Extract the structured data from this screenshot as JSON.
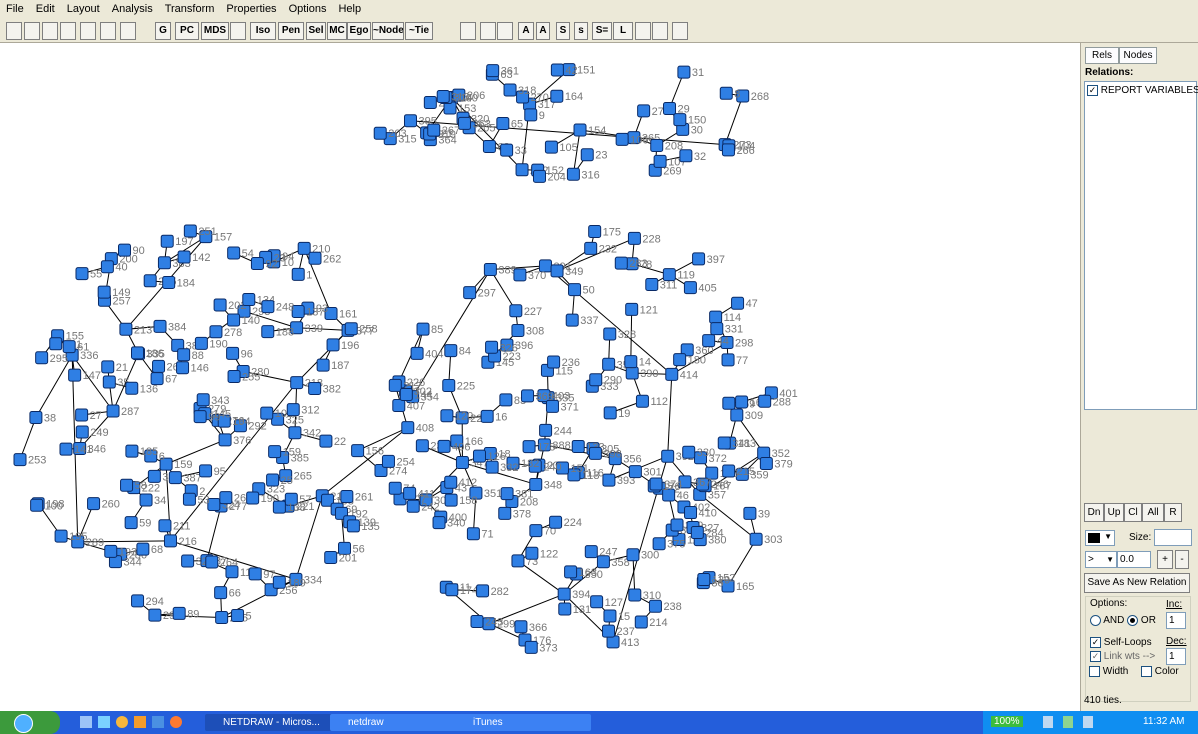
{
  "menu": [
    "File",
    "Edit",
    "Layout",
    "Analysis",
    "Transform",
    "Properties",
    "Options",
    "Help"
  ],
  "toolbar_labels": [
    "G",
    "PC",
    "MDS",
    "Iso",
    "Pen",
    "Sel",
    "MC",
    "Ego",
    "~Node",
    "~Tie",
    "A",
    "A",
    "S",
    "s",
    "S=",
    "L"
  ],
  "side": {
    "tab_rels": "Rels",
    "tab_nodes": "Nodes",
    "relations_label": "Relations:",
    "relation_item": "REPORT VARIABLES F",
    "btn_dn": "Dn",
    "btn_up": "Up",
    "btn_cl": "Cl",
    "btn_all": "All",
    "btn_r": "R",
    "size_label": "Size:",
    "op_value": ">",
    "threshold": "0.0",
    "btn_plus": "+",
    "btn_minus": "-",
    "save_btn": "Save As New Relation",
    "options_label": "Options:",
    "inc_label": "Inc:",
    "inc_value": "1",
    "and_label": "AND",
    "or_label": "OR",
    "self_loops": "Self-Loops",
    "dec_label": "Dec:",
    "dec_value": "1",
    "link_wts": "Link wts -->",
    "width_label": "Width",
    "color_label": "Color",
    "status": "410 ties."
  },
  "taskbar": {
    "btn1": "NETDRAW - Micros...",
    "btn2": "netdraw",
    "btn3": "iTunes",
    "battery": "100%",
    "clock": "11:32 AM"
  },
  "colors": {
    "node_fill": "#2f7fe4",
    "node_stroke": "#0a2a66",
    "label": "#777777"
  },
  "network": {
    "labels": [
      "395",
      "365",
      "321",
      "273",
      "200",
      "272",
      "317",
      "320",
      "270",
      "207",
      "154",
      "268",
      "208",
      "271",
      "364",
      "318",
      "269",
      "205",
      "153",
      "107",
      "62",
      "104",
      "316",
      "363",
      "206",
      "151",
      "106",
      "65",
      "30",
      "63",
      "29",
      "319",
      "315",
      "267",
      "105",
      "164",
      "152",
      "31",
      "8",
      "42",
      "9",
      "33",
      "23",
      "361",
      "204",
      "150",
      "314",
      "266",
      "203",
      "313",
      "32",
      "414",
      "392",
      "391",
      "389",
      "413",
      "393",
      "356",
      "354",
      "390",
      "388",
      "394",
      "357",
      "358",
      "353",
      "305",
      "355",
      "348",
      "347",
      "352",
      "306",
      "299",
      "349",
      "350",
      "303",
      "301",
      "300",
      "359",
      "351",
      "302",
      "229",
      "165",
      "227",
      "298",
      "307",
      "360",
      "231",
      "228",
      "226",
      "297",
      "234",
      "309",
      "308",
      "232",
      "166",
      "114",
      "167",
      "74",
      "115",
      "236",
      "310",
      "116",
      "169",
      "168",
      "238",
      "237",
      "176",
      "145",
      "14",
      "73",
      "44",
      "72",
      "18",
      "71",
      "113",
      "39",
      "43",
      "112",
      "208",
      "151",
      "152",
      "19",
      "16",
      "70",
      "50",
      "15",
      "47",
      "111",
      "121",
      "46",
      "86",
      "85",
      "163",
      "224",
      "77",
      "78",
      "131",
      "129",
      "162",
      "122",
      "225",
      "118",
      "119",
      "120",
      "223",
      "176",
      "174",
      "175",
      "242",
      "240",
      "180",
      "247",
      "246",
      "243",
      "311",
      "244",
      "182",
      "126",
      "127",
      "83",
      "84",
      "178",
      "183",
      "133",
      "403",
      "402",
      "400",
      "401",
      "398",
      "397",
      "405",
      "404",
      "372",
      "371",
      "396",
      "373",
      "369",
      "370",
      "330",
      "368",
      "367",
      "406",
      "407",
      "410",
      "374",
      "375",
      "329",
      "327",
      "366",
      "412",
      "331",
      "282",
      "332",
      "328",
      "326",
      "411",
      "380",
      "381",
      "283",
      "214",
      "284",
      "333",
      "378",
      "341",
      "337",
      "215",
      "158",
      "379",
      "340",
      "290",
      "288",
      "218",
      "216",
      "377",
      "339",
      "289",
      "334",
      "336",
      "286",
      "217",
      "159",
      "287",
      "408",
      "335",
      "285",
      "66",
      "213",
      "280",
      "376",
      "157",
      "279",
      "342",
      "291",
      "292",
      "110",
      "67",
      "37",
      "108",
      "156",
      "383",
      "382",
      "161",
      "343",
      "221",
      "38",
      "155",
      "212",
      "277",
      "384",
      "293",
      "222",
      "294",
      "276",
      "211",
      "210",
      "278",
      "344",
      "295",
      "35",
      "10",
      "1",
      "275",
      "274",
      "325",
      "346",
      "345",
      "34",
      "324",
      "323",
      "322",
      "387",
      "386",
      "385",
      "69",
      "68",
      "261",
      "262",
      "260",
      "263",
      "196",
      "264",
      "159",
      "257",
      "256",
      "197",
      "193",
      "191",
      "258",
      "195",
      "142",
      "194",
      "192",
      "144",
      "95",
      "140",
      "200",
      "265",
      "96",
      "56",
      "94",
      "141",
      "146",
      "190",
      "201",
      "145",
      "97",
      "57",
      "198",
      "147",
      "202",
      "2",
      "25",
      "58",
      "99",
      "5",
      "59",
      "40",
      "26",
      "102",
      "255",
      "6",
      "61",
      "100",
      "190",
      "27",
      "23",
      "92",
      "139",
      "89",
      "55",
      "90",
      "189",
      "22",
      "21",
      "93",
      "53",
      "138",
      "149",
      "54",
      "88",
      "137",
      "134",
      "136",
      "188",
      "184",
      "135",
      "187",
      "248",
      "186",
      "185",
      "249",
      "253",
      "251",
      "254",
      "312"
    ]
  }
}
